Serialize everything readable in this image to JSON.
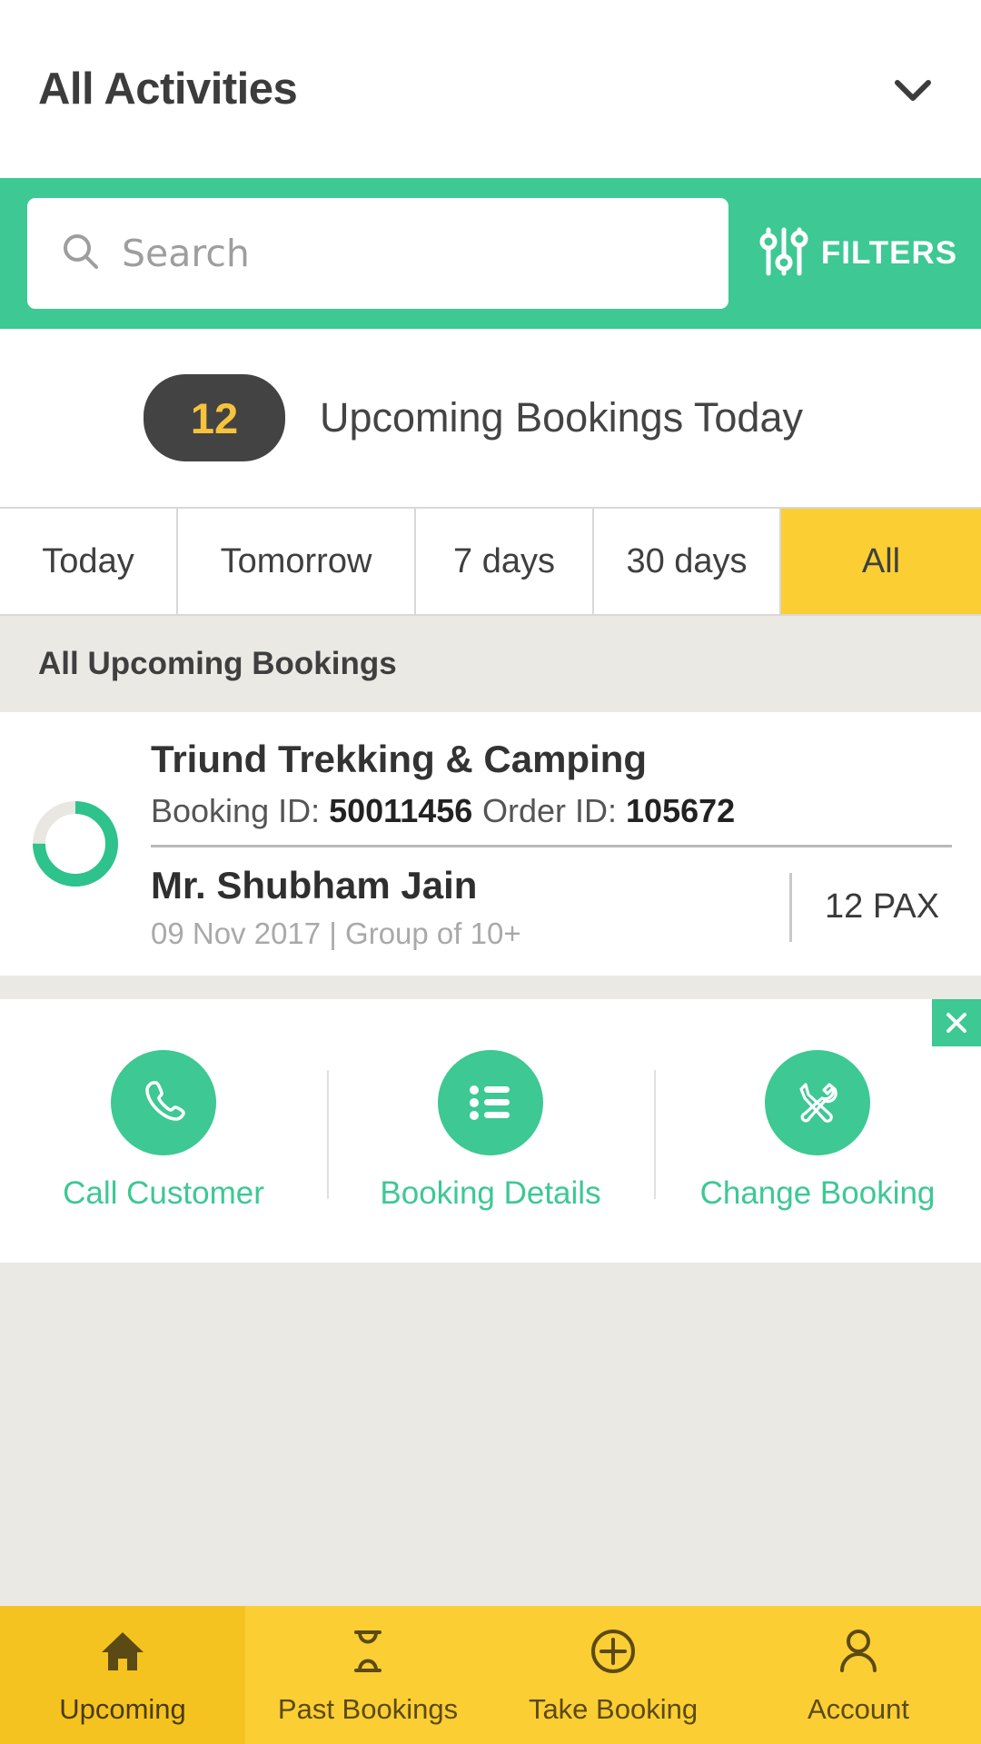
{
  "header": {
    "title": "All Activities",
    "chevron_icon": "chevron-down-icon"
  },
  "search": {
    "placeholder": "Search",
    "value": "",
    "search_icon": "search-icon",
    "filters_label": "FILTERS",
    "filters_icon": "sliders-icon",
    "bar_color": "#3dc894"
  },
  "summary": {
    "count": "12",
    "label": "Upcoming Bookings Today",
    "badge_bg": "#434343",
    "badge_text_color": "#f6c33c"
  },
  "tabs": {
    "active_color": "#fbce33",
    "items": [
      {
        "label": "Today",
        "active": false
      },
      {
        "label": "Tomorrow",
        "active": false
      },
      {
        "label": "7 days",
        "active": false
      },
      {
        "label": "30 days",
        "active": false
      },
      {
        "label": "All",
        "active": true
      }
    ]
  },
  "section": {
    "title": "All Upcoming Bookings"
  },
  "booking": {
    "progress_icon": "progress-ring-icon",
    "progress_percent": 75,
    "progress_color": "#2ec28c",
    "progress_track_color": "#e8e7e2",
    "activity_name": "Triund Trekking & Camping",
    "booking_id_label": "Booking ID:",
    "booking_id_value": "50011456",
    "order_id_label": "Order ID:",
    "order_id_value": "105672",
    "customer_name": "Mr. Shubham Jain",
    "customer_meta": "09 Nov 2017  |  Group of 10+",
    "pax": "12 PAX"
  },
  "actions": {
    "close_icon": "close-icon",
    "accent": "#3dc894",
    "items": [
      {
        "label": "Call Customer",
        "icon": "phone-icon"
      },
      {
        "label": "Booking Details",
        "icon": "list-icon"
      },
      {
        "label": "Change Booking",
        "icon": "tools-icon"
      }
    ]
  },
  "bottomnav": {
    "bg": "#fbce33",
    "items": [
      {
        "label": "Upcoming",
        "icon": "home-icon",
        "active": true
      },
      {
        "label": "Past Bookings",
        "icon": "hourglass-icon",
        "active": false
      },
      {
        "label": "Take Booking",
        "icon": "plus-circle-icon",
        "active": false
      },
      {
        "label": "Account",
        "icon": "person-icon",
        "active": false
      }
    ]
  }
}
